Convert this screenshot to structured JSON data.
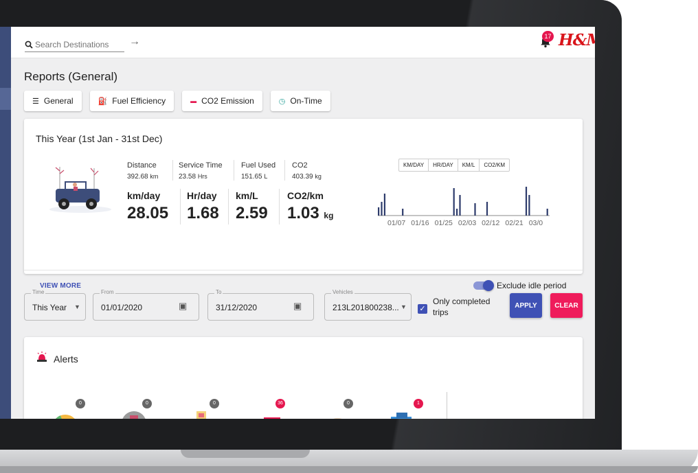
{
  "search": {
    "placeholder": "Search Destinations"
  },
  "header": {
    "notification_count": "17",
    "logo_text": "H&M"
  },
  "page_title": "Reports (General)",
  "tabs": [
    {
      "label": "General",
      "icon": "menu-icon"
    },
    {
      "label": "Fuel Efficiency",
      "icon": "fuel-icon"
    },
    {
      "label": "CO2 Emission",
      "icon": "car-icon"
    },
    {
      "label": "On-Time",
      "icon": "clock-icon"
    }
  ],
  "year_card": {
    "title": "This Year (1st Jan - 31st Dec)",
    "stats": [
      {
        "label": "Distance",
        "value": "392.68",
        "unit": "km"
      },
      {
        "label": "Service Time",
        "value": "23.58",
        "unit": "Hrs"
      },
      {
        "label": "Fuel Used",
        "value": "151.65",
        "unit": "L"
      },
      {
        "label": "CO2",
        "value": "403.39",
        "unit": "kg"
      }
    ],
    "metrics": [
      {
        "label": "km/day",
        "value": "28.05",
        "unit": ""
      },
      {
        "label": "Hr/day",
        "value": "1.68",
        "unit": ""
      },
      {
        "label": "km/L",
        "value": "2.59",
        "unit": ""
      },
      {
        "label": "CO2/km",
        "value": "1.03",
        "unit": "kg"
      }
    ],
    "chart_tabs": [
      "KM/DAY",
      "HR/DAY",
      "KM/L",
      "CO2/KM"
    ],
    "view_more": "VIEW MORE",
    "exclude_idle_label": "Exclude idle period",
    "exclude_idle_on": true
  },
  "chart_data": {
    "type": "bar",
    "x_tick_labels": [
      "01/07",
      "01/16",
      "01/25",
      "02/03",
      "02/12",
      "02/21",
      "03/0"
    ],
    "values": [
      12,
      20,
      32,
      0,
      0,
      0,
      0,
      0,
      10,
      0,
      0,
      0,
      0,
      0,
      0,
      0,
      0,
      0,
      0,
      0,
      0,
      0,
      0,
      0,
      0,
      40,
      10,
      30,
      0,
      0,
      0,
      0,
      18,
      0,
      0,
      0,
      20,
      0,
      0,
      0,
      0,
      0,
      0,
      0,
      0,
      0,
      0,
      0,
      0,
      42,
      30,
      0,
      0,
      0,
      0,
      0,
      10
    ],
    "bar_color": "#2d3b6b"
  },
  "filters": {
    "time": {
      "legend": "Time",
      "value": "This Year"
    },
    "from": {
      "legend": "From",
      "value": "01/01/2020"
    },
    "to": {
      "legend": "To",
      "value": "31/12/2020"
    },
    "vehicles": {
      "legend": "Vehicles",
      "value": "213L201800238..."
    },
    "only_completed_label_1": "Only completed",
    "only_completed_label_2": "trips",
    "only_completed_checked": true,
    "apply_label": "APPLY",
    "clear_label": "CLEAR"
  },
  "alerts": {
    "title": "Alerts",
    "items": [
      {
        "badge": "0",
        "badge_color": "#666666"
      },
      {
        "badge": "0",
        "badge_color": "#666666"
      },
      {
        "badge": "0",
        "badge_color": "#666666"
      },
      {
        "badge": "36",
        "badge_color": "#e5174f"
      },
      {
        "badge": "0",
        "badge_color": "#666666"
      },
      {
        "badge": "1",
        "badge_color": "#e5174f"
      }
    ]
  },
  "colors": {
    "primary": "#3f51b5",
    "accent": "#ef1b5b",
    "sidebar": "#3d4d7a"
  }
}
